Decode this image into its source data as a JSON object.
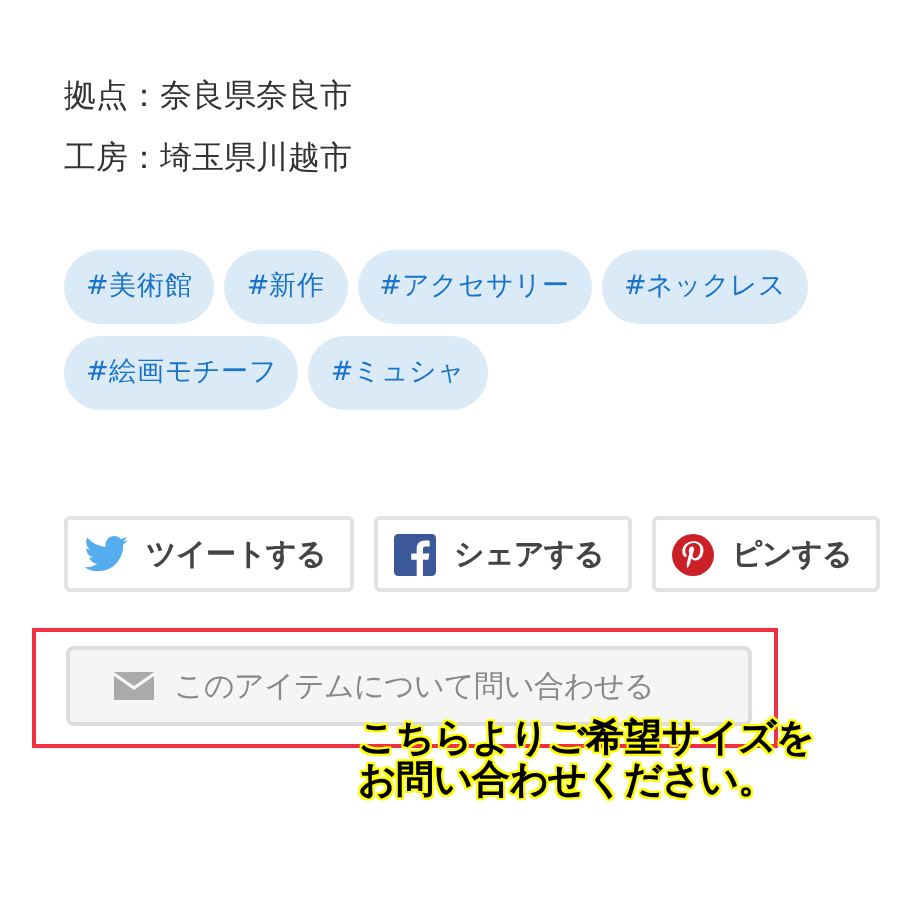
{
  "info_lines": [
    "拠点：奈良県奈良市",
    "工房：埼玉県川越市"
  ],
  "tags": [
    "#美術館",
    "#新作",
    "#アクセサリー",
    "#ネックレス",
    "#絵画モチーフ",
    "#ミュシャ"
  ],
  "share_buttons": [
    {
      "kind": "twitter",
      "label": "ツイートする"
    },
    {
      "kind": "facebook",
      "label": "シェアする"
    },
    {
      "kind": "pinterest",
      "label": "ピンする"
    }
  ],
  "contact_button": {
    "label": "このアイテムについて問い合わせる"
  },
  "annotation": {
    "lines": [
      "こちらよりご希望サイズを",
      "お問い合わせください。"
    ]
  }
}
